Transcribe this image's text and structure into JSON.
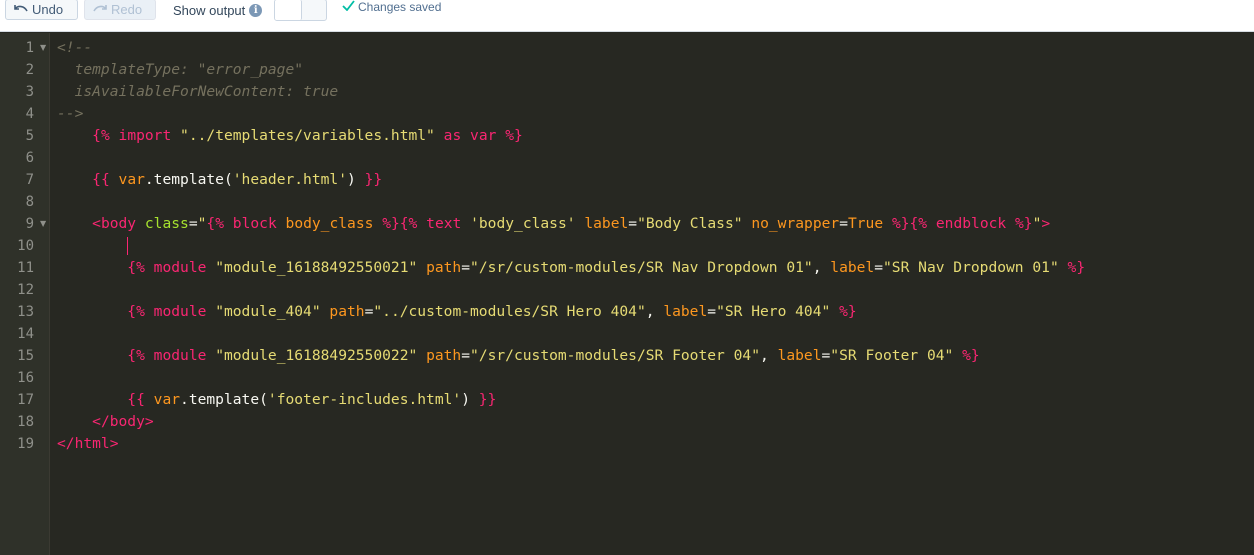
{
  "toolbar": {
    "undo_label": "Undo",
    "redo_label": "Redo",
    "show_output_label": "Show output",
    "status_text": "Changes saved"
  },
  "editor": {
    "lines": [
      {
        "no": "1",
        "fold": true,
        "tokens": [
          [
            "cm",
            "<!--"
          ]
        ]
      },
      {
        "no": "2",
        "tokens": [
          [
            "cm",
            "  templateType: \"error_page\""
          ]
        ]
      },
      {
        "no": "3",
        "tokens": [
          [
            "cm",
            "  isAvailableForNewContent: true"
          ]
        ]
      },
      {
        "no": "4",
        "tokens": [
          [
            "cm",
            "-->"
          ]
        ]
      },
      {
        "no": "5",
        "tokens": [
          [
            "id",
            "    "
          ],
          [
            "tg",
            "{%"
          ],
          [
            "id",
            " "
          ],
          [
            "tg",
            "import"
          ],
          [
            "id",
            " "
          ],
          [
            "st",
            "\"../templates/variables.html\""
          ],
          [
            "id",
            " "
          ],
          [
            "tg",
            "as"
          ],
          [
            "id",
            " "
          ],
          [
            "tg",
            "var"
          ],
          [
            "id",
            " "
          ],
          [
            "tg",
            "%}"
          ]
        ]
      },
      {
        "no": "6",
        "tokens": []
      },
      {
        "no": "7",
        "tokens": [
          [
            "id",
            "    "
          ],
          [
            "tg",
            "{{"
          ],
          [
            "id",
            " "
          ],
          [
            "kw",
            "var"
          ],
          [
            "id",
            ".template("
          ],
          [
            "st",
            "'header.html'"
          ],
          [
            "id",
            ") "
          ],
          [
            "tg",
            "}}"
          ]
        ]
      },
      {
        "no": "8",
        "tokens": []
      },
      {
        "no": "9",
        "fold": true,
        "tokens": [
          [
            "id",
            "    "
          ],
          [
            "tg",
            "<body"
          ],
          [
            "id",
            " "
          ],
          [
            "at",
            "class"
          ],
          [
            "id",
            "="
          ],
          [
            "st",
            "\""
          ],
          [
            "tg",
            "{%"
          ],
          [
            "id",
            " "
          ],
          [
            "tg",
            "block"
          ],
          [
            "id",
            " "
          ],
          [
            "kw",
            "body_class"
          ],
          [
            "id",
            " "
          ],
          [
            "tg",
            "%}{%"
          ],
          [
            "id",
            " "
          ],
          [
            "tg",
            "text"
          ],
          [
            "id",
            " "
          ],
          [
            "st",
            "'body_class'"
          ],
          [
            "id",
            " "
          ],
          [
            "kw",
            "label"
          ],
          [
            "id",
            "="
          ],
          [
            "st",
            "\"Body Class\""
          ],
          [
            "id",
            " "
          ],
          [
            "kw",
            "no_wrapper"
          ],
          [
            "id",
            "="
          ],
          [
            "kw",
            "True"
          ],
          [
            "id",
            " "
          ],
          [
            "tg",
            "%}{%"
          ],
          [
            "id",
            " "
          ],
          [
            "tg",
            "endblock"
          ],
          [
            "id",
            " "
          ],
          [
            "tg",
            "%}"
          ],
          [
            "st",
            "\""
          ],
          [
            "tg",
            ">"
          ]
        ]
      },
      {
        "no": "10",
        "tokens": []
      },
      {
        "no": "11",
        "tokens": [
          [
            "id",
            "        "
          ],
          [
            "tg",
            "{%"
          ],
          [
            "id",
            " "
          ],
          [
            "tg",
            "module"
          ],
          [
            "id",
            " "
          ],
          [
            "st",
            "\"module_16188492550021\""
          ],
          [
            "id",
            " "
          ],
          [
            "kw",
            "path"
          ],
          [
            "id",
            "="
          ],
          [
            "st",
            "\"/sr/custom-modules/SR Nav Dropdown 01\""
          ],
          [
            "id",
            ", "
          ],
          [
            "kw",
            "label"
          ],
          [
            "id",
            "="
          ],
          [
            "st",
            "\"SR Nav Dropdown 01\""
          ],
          [
            "id",
            " "
          ],
          [
            "tg",
            "%}"
          ]
        ]
      },
      {
        "no": "12",
        "tokens": []
      },
      {
        "no": "13",
        "tokens": [
          [
            "id",
            "        "
          ],
          [
            "tg",
            "{%"
          ],
          [
            "id",
            " "
          ],
          [
            "tg",
            "module"
          ],
          [
            "id",
            " "
          ],
          [
            "st",
            "\"module_404\""
          ],
          [
            "id",
            " "
          ],
          [
            "kw",
            "path"
          ],
          [
            "id",
            "="
          ],
          [
            "st",
            "\"../custom-modules/SR Hero 404\""
          ],
          [
            "id",
            ", "
          ],
          [
            "kw",
            "label"
          ],
          [
            "id",
            "="
          ],
          [
            "st",
            "\"SR Hero 404\""
          ],
          [
            "id",
            " "
          ],
          [
            "tg",
            "%}"
          ]
        ]
      },
      {
        "no": "14",
        "tokens": []
      },
      {
        "no": "15",
        "tokens": [
          [
            "id",
            "        "
          ],
          [
            "tg",
            "{%"
          ],
          [
            "id",
            " "
          ],
          [
            "tg",
            "module"
          ],
          [
            "id",
            " "
          ],
          [
            "st",
            "\"module_16188492550022\""
          ],
          [
            "id",
            " "
          ],
          [
            "kw",
            "path"
          ],
          [
            "id",
            "="
          ],
          [
            "st",
            "\"/sr/custom-modules/SR Footer 04\""
          ],
          [
            "id",
            ", "
          ],
          [
            "kw",
            "label"
          ],
          [
            "id",
            "="
          ],
          [
            "st",
            "\"SR Footer 04\""
          ],
          [
            "id",
            " "
          ],
          [
            "tg",
            "%}"
          ]
        ]
      },
      {
        "no": "16",
        "tokens": []
      },
      {
        "no": "17",
        "tokens": [
          [
            "id",
            "        "
          ],
          [
            "tg",
            "{{"
          ],
          [
            "id",
            " "
          ],
          [
            "kw",
            "var"
          ],
          [
            "id",
            ".template("
          ],
          [
            "st",
            "'footer-includes.html'"
          ],
          [
            "id",
            ") "
          ],
          [
            "tg",
            "}}"
          ]
        ]
      },
      {
        "no": "18",
        "tokens": [
          [
            "id",
            "    "
          ],
          [
            "tg",
            "</body>"
          ]
        ]
      },
      {
        "no": "19",
        "tokens": [
          [
            "tg",
            "</html>"
          ]
        ]
      }
    ]
  },
  "colors": {
    "editor_bg": "#272822",
    "gutter_bg": "#2f3129",
    "comment": "#75715e",
    "tag": "#f92672",
    "string": "#e6db74",
    "keyword": "#fd971f",
    "attribute": "#a6e22e",
    "success": "#00bda5"
  }
}
